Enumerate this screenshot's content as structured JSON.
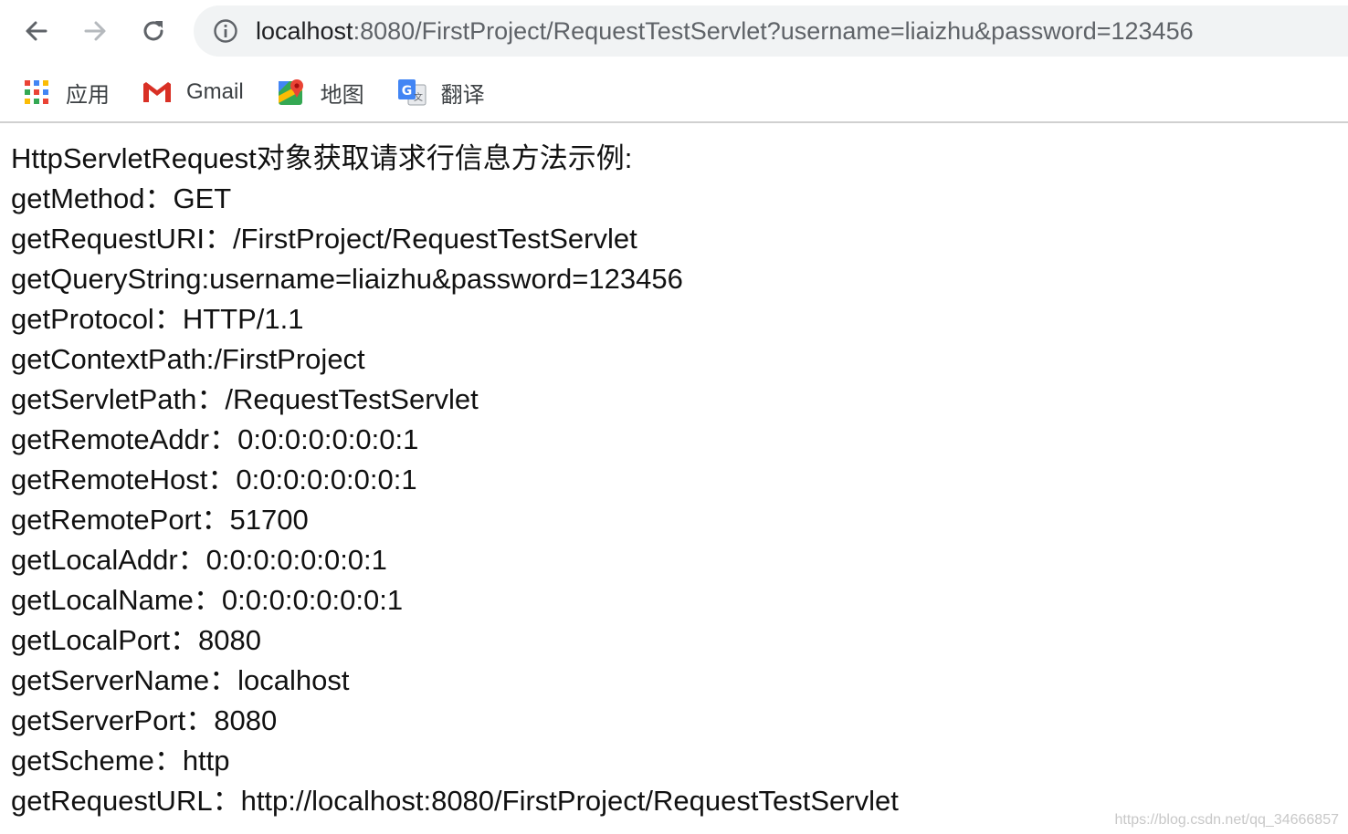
{
  "browser": {
    "address_bar": {
      "host": "localhost",
      "rest": ":8080/FirstProject/RequestTestServlet?username=liaizhu&password=123456"
    },
    "bookmarks": [
      {
        "label": "应用",
        "icon": "apps-grid-icon"
      },
      {
        "label": "Gmail",
        "icon": "gmail-icon"
      },
      {
        "label": "地图",
        "icon": "maps-icon"
      },
      {
        "label": "翻译",
        "icon": "translate-icon"
      }
    ]
  },
  "page": {
    "lines": [
      "HttpServletRequest对象获取请求行信息方法示例:",
      "getMethod：GET",
      "getRequestURI：/FirstProject/RequestTestServlet",
      "getQueryString:username=liaizhu&password=123456",
      "getProtocol：HTTP/1.1",
      "getContextPath:/FirstProject",
      "getServletPath：/RequestTestServlet",
      "getRemoteAddr：0:0:0:0:0:0:0:1",
      "getRemoteHost：0:0:0:0:0:0:0:1",
      "getRemotePort：51700",
      "getLocalAddr：0:0:0:0:0:0:0:1",
      "getLocalName：0:0:0:0:0:0:0:1",
      "getLocalPort：8080",
      "getServerName：localhost",
      "getServerPort：8080",
      "getScheme：http",
      "getRequestURL：http://localhost:8080/FirstProject/RequestTestServlet"
    ]
  },
  "watermark": "https://blog.csdn.net/qq_34666857",
  "colors": {
    "omnibox_bg": "#f1f3f4",
    "icon_gray": "#5f6368",
    "text": "#111111"
  }
}
